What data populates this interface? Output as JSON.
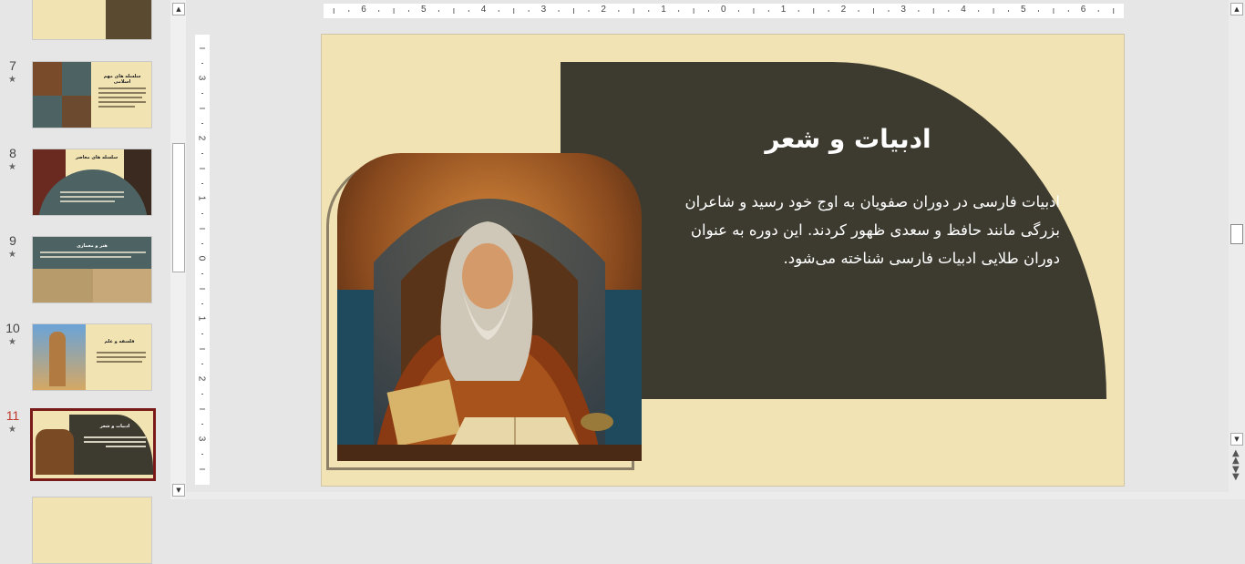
{
  "thumbnails": [
    {
      "num": "7",
      "title": "سلسله های مهم اسلامی"
    },
    {
      "num": "8",
      "title": "سلسله های معاصر"
    },
    {
      "num": "9",
      "title": "هنر و معماری"
    },
    {
      "num": "10",
      "title": "فلسفه و علم"
    },
    {
      "num": "11",
      "title": "ادبیات و شعر"
    }
  ],
  "star_glyph": "★",
  "ruler": {
    "h_labels": [
      "6",
      "5",
      "4",
      "3",
      "2",
      "1",
      "0",
      "1",
      "2",
      "3",
      "4",
      "5",
      "6"
    ],
    "v_labels": [
      "3",
      "2",
      "1",
      "0",
      "1",
      "2",
      "3"
    ]
  },
  "slide": {
    "title": "ادبیات و شعر",
    "body": "ادبیات فارسی در دوران صفویان به اوج خود رسید و شاعران بزرگی مانند حافظ و سعدی ظهور کردند. این دوره به عنوان دوران طلایی ادبیات فارسی شناخته می‌شود."
  },
  "colors": {
    "slide_bg": "#f1e3b3",
    "dark_shape": "#3d3b30",
    "selected_border": "#7a1b1b",
    "selected_num": "#c0392b"
  }
}
